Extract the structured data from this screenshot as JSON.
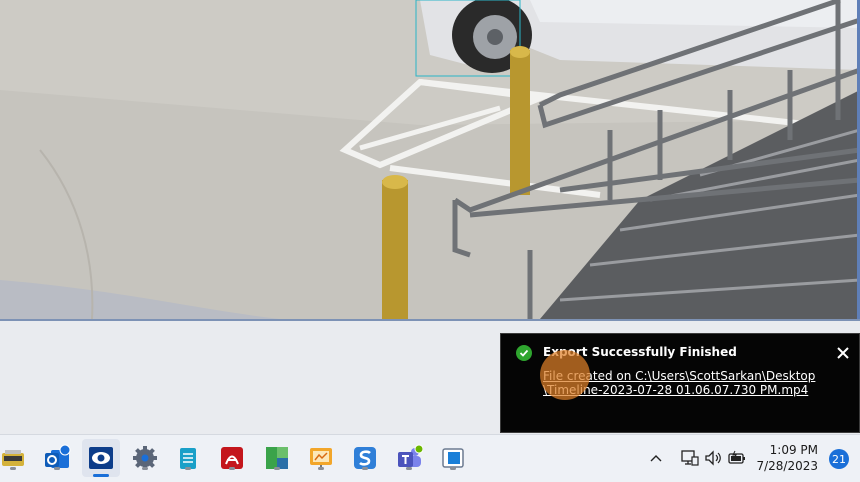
{
  "toast": {
    "title": "Export Successfully Finished",
    "link_line1": "File created on C:\\Users\\ScottSarkan\\Desktop",
    "link_line2": "\\Timeline-2023-07-28 01.06.07.730 PM.mp4"
  },
  "taskbar": {
    "apps": [
      {
        "name": "qpdf-icon"
      },
      {
        "name": "outlook-icon"
      },
      {
        "name": "surveillance-viewer-icon",
        "active": true
      },
      {
        "name": "settings-gear-icon"
      },
      {
        "name": "notepad-icon"
      },
      {
        "name": "acrobat-icon"
      },
      {
        "name": "app-green-blue-icon"
      },
      {
        "name": "presentation-icon"
      },
      {
        "name": "snagit-icon"
      },
      {
        "name": "teams-icon"
      },
      {
        "name": "window-app-icon"
      }
    ],
    "time": "1:09 PM",
    "date": "7/28/2023",
    "notification_count": "21"
  },
  "colors": {
    "toast_bg": "#050505",
    "success_green": "#2fa52f",
    "accent_blue": "#1a6fd8"
  }
}
